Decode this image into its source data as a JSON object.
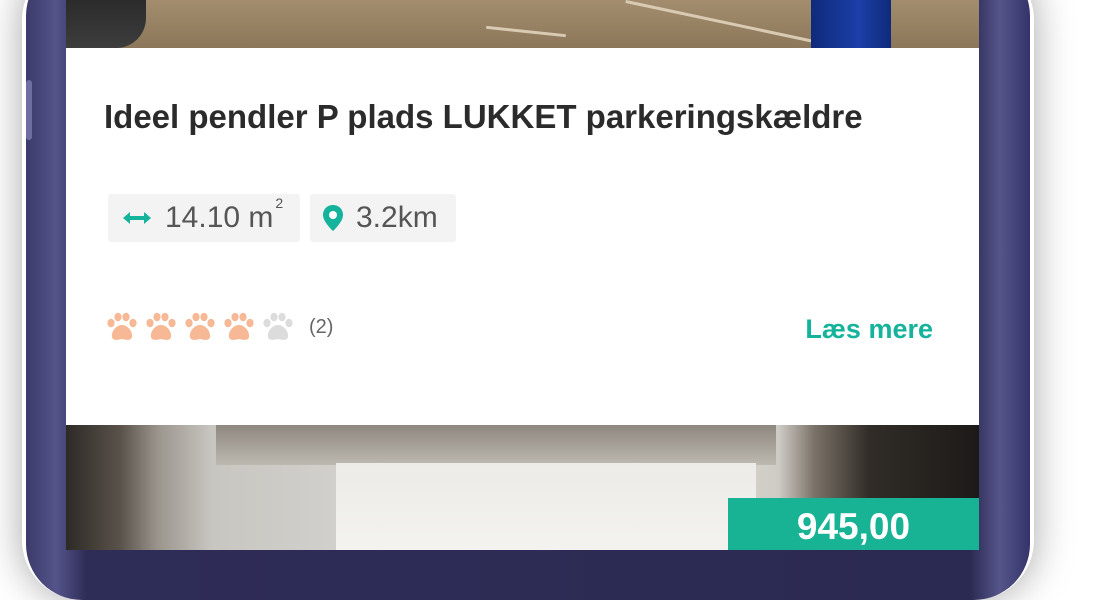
{
  "listing": {
    "title": "Ideel pendler P plads LUKKET parkeringskældre",
    "size": {
      "value": "14.10 m",
      "unit_sup": "2"
    },
    "distance": "3.2km",
    "rating": {
      "filled": 4,
      "total": 5,
      "count_label": "(2)"
    },
    "read_more_label": "Læs mere"
  },
  "next_listing": {
    "price": "945,00"
  },
  "colors": {
    "accent": "#15b39b",
    "paw_filled": "#f7b895",
    "paw_empty": "#dcdcdc",
    "price_bg": "#17b394"
  }
}
